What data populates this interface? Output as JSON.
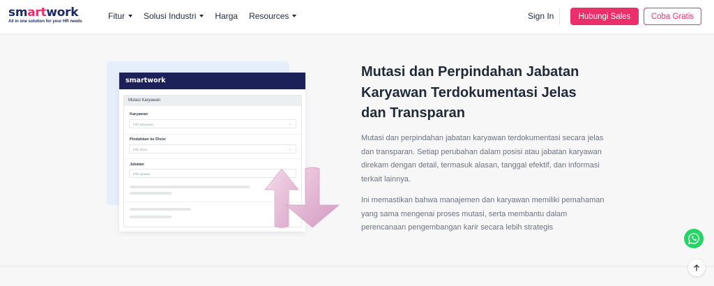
{
  "nav": {
    "logo": {
      "prefix": "sm",
      "accent": "art",
      "suffix": "work",
      "tagline": "All in one solution for your HR needs"
    },
    "menu": [
      {
        "label": "Fitur",
        "has_dropdown": true
      },
      {
        "label": "Solusi Industri",
        "has_dropdown": true
      },
      {
        "label": "Harga",
        "has_dropdown": false
      },
      {
        "label": "Resources",
        "has_dropdown": true
      }
    ],
    "sign_in": "Sign In",
    "contact_sales": "Hubungi Sales",
    "try_free": "Coba Gratis"
  },
  "illustration": {
    "app_name": "smartwork",
    "panel_title": "Mutasi Karyawan",
    "fields": [
      {
        "label": "Karyawan",
        "placeholder": "Pilih karyawan",
        "dropdown": true
      },
      {
        "label": "Pindahkan ke Divisi",
        "placeholder": "Pilih divisi",
        "dropdown": true
      },
      {
        "label": "Jabatan",
        "placeholder": "Pilih jabatan",
        "dropdown": false
      }
    ],
    "icon": "swap-arrows-icon"
  },
  "content": {
    "heading": "Mutasi dan Perpindahan Jabatan Karyawan Terdokumentasi Jelas dan Transparan",
    "paragraph1": "Mutasi dan perpindahan jabatan karyawan terdokumentasi secara jelas dan transparan. Setiap perubahan dalam posisi atau jabatan karyawan direkam dengan detail, termasuk alasan, tanggal efektif, dan informasi terkait lainnya.",
    "paragraph2": "Ini memastikan bahwa manajemen dan karyawan memiliki pemahaman yang sama mengenai proses mutasi, serta membantu dalam perencanaan pengembangan karir secara lebih strategis"
  },
  "floating": {
    "whatsapp_icon": "whatsapp-icon",
    "back_to_top_icon": "arrow-up-icon"
  },
  "colors": {
    "brand_pink": "#ec2e6b",
    "brand_navy": "#1d2a6b",
    "whatsapp_green": "#25d366"
  }
}
